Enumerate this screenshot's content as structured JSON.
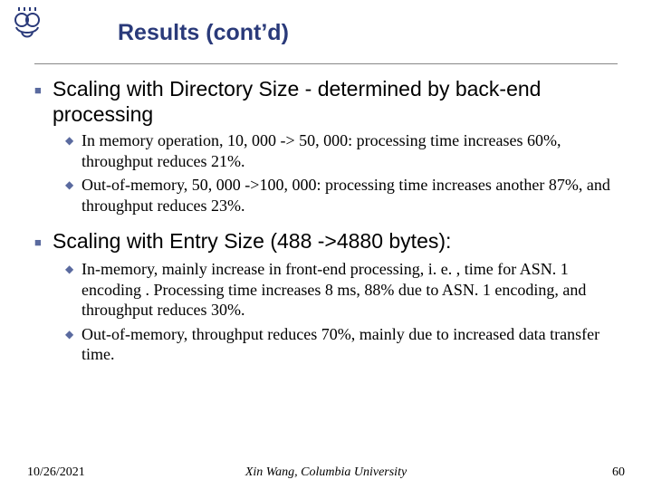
{
  "title": "Results (cont’d)",
  "bullets": [
    {
      "text": "Scaling with Directory Size - determined by back-end processing",
      "sub": [
        "In memory operation, 10, 000 -> 50, 000: processing time increases 60%, throughput reduces 21%.",
        "Out-of-memory, 50, 000 ->100, 000: processing time increases another 87%, and throughput reduces 23%."
      ]
    },
    {
      "text": "Scaling with Entry Size (488 ->4880 bytes):",
      "sub": [
        "In-memory, mainly increase in front-end processing, i. e. , time for ASN. 1 encoding . Processing time  increases 8 ms, 88% due to ASN. 1 encoding, and throughput  reduces 30%.",
        "Out-of-memory, throughput reduces 70%, mainly due to increased data transfer time."
      ]
    }
  ],
  "footer": {
    "date": "10/26/2021",
    "center": "Xin Wang, Columbia University",
    "page": "60"
  },
  "logo_name": "crown-crest-icon",
  "colors": {
    "accent": "#2a3a7a",
    "bullet": "#5a6a9f"
  }
}
